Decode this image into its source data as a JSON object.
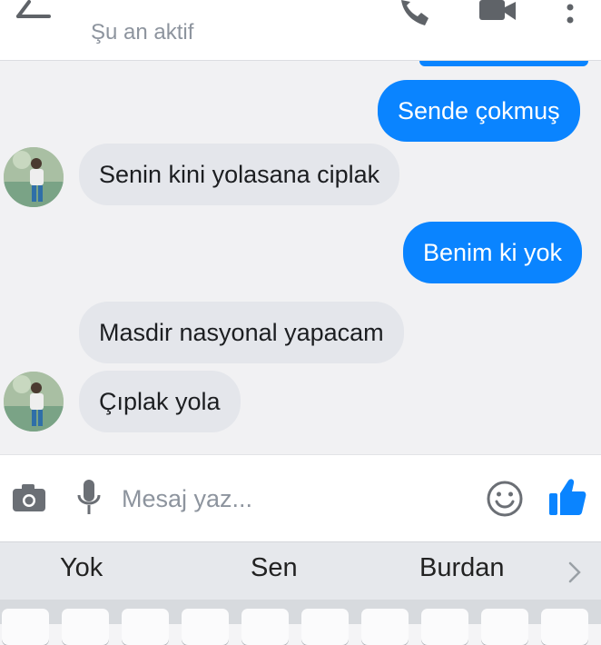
{
  "header": {
    "status": "Şu an aktif",
    "back_icon": "arrow-left-icon",
    "call_icon": "phone-icon",
    "video_icon": "video-camera-icon",
    "more_icon": "more-vertical-icon"
  },
  "messages": [
    {
      "direction": "outgoing",
      "text": "Sende çokmuş"
    },
    {
      "direction": "incoming",
      "text": "Senin kini yolasana ciplak"
    },
    {
      "direction": "outgoing",
      "text": "Benim ki yok"
    },
    {
      "direction": "incoming",
      "text": "Masdir nasyonal yapacam"
    },
    {
      "direction": "incoming",
      "text": "Çıplak yola"
    }
  ],
  "composer": {
    "placeholder": "Mesaj yaz...",
    "camera_icon": "camera-icon",
    "mic_icon": "microphone-icon",
    "emoji_icon": "smiley-icon",
    "like_icon": "thumbs-up-icon"
  },
  "suggestions": [
    "Yok",
    "Sen",
    "Burdan"
  ],
  "colors": {
    "accent": "#0a84ff",
    "incoming_bubble": "#e4e6eb",
    "background": "#f1f1f3"
  }
}
